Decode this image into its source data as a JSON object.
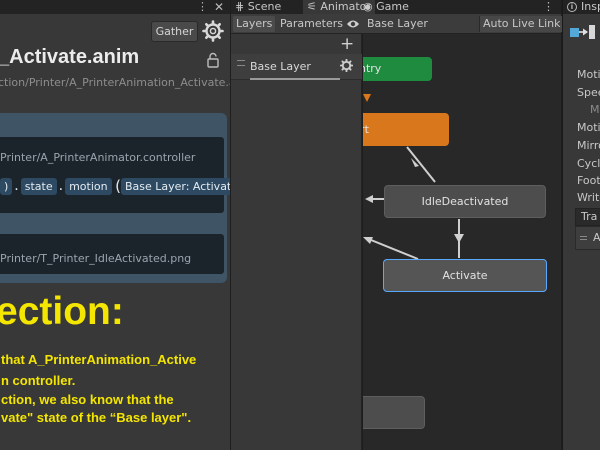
{
  "left_panel": {
    "gather_label": "Gather",
    "asset_title": "_Activate.anim",
    "asset_path": "ction/Printer/A_PrinterAnimation_Activate.anim",
    "controller_path": "Printer/A_PrinterAnimator.controller",
    "chip_paren_close_left": ")",
    "chip_state": "state",
    "chip_motion": "motion",
    "chip_layer_state": "Base Layer: Activate",
    "png_path": "Printer/T_Printer_IdleActivated.png",
    "conclusion_heading": "ection:",
    "conclusion_lines": [
      "that A_PrinterAnimation_Active",
      "n controller.",
      "ction, we also know that the",
      "vate\" state of the “Base layer\"."
    ]
  },
  "animator": {
    "tabs": [
      "Scene",
      "Animator",
      "Game",
      "⋮"
    ],
    "toolbar": {
      "layers": "Layers",
      "parameters": "Parameters",
      "breadcrumb": "Base Layer",
      "auto_live_link": "Auto Live Link"
    },
    "add_layer": "+",
    "layer_name": "Base Layer",
    "states": {
      "entry": "ntry",
      "start": "tart",
      "idle": "IdleDeactivated",
      "activate": "Activate"
    }
  },
  "inspector": {
    "tab": "Insp",
    "rows": [
      "Motio",
      "Spee",
      "M",
      "Motio",
      "Mirro",
      "Cycle",
      "Foot",
      "Write"
    ],
    "transitions_header": "Tra",
    "transition_item": "A"
  },
  "colors": {
    "entry_green": "#1e8b3e",
    "start_orange": "#d8771b",
    "selected_blue": "#58a8ff",
    "highlight_yellow": "#f4e600"
  }
}
